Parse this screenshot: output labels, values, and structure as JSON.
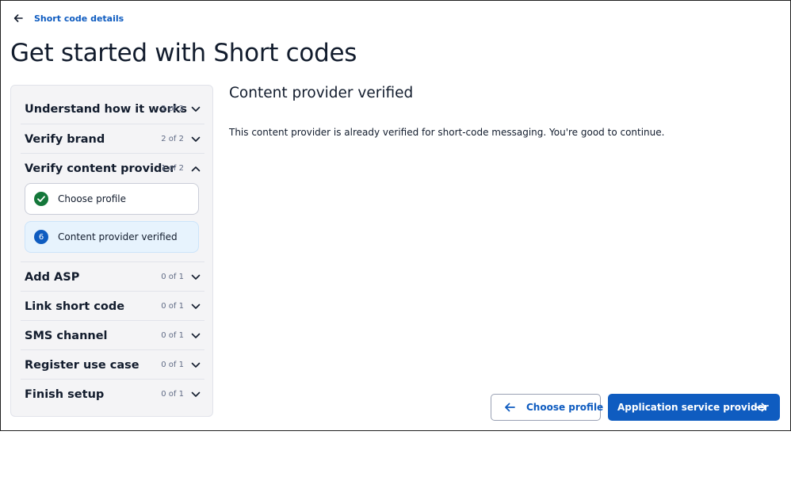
{
  "breadcrumb": {
    "label": "Short code details"
  },
  "page": {
    "title": "Get started with Short codes"
  },
  "steps": [
    {
      "title": "Understand how it works",
      "count": "2 of 2",
      "expanded": false
    },
    {
      "title": "Verify brand",
      "count": "2 of 2",
      "expanded": false
    },
    {
      "title": "Verify content provider",
      "count": "1 of 2",
      "expanded": true
    },
    {
      "title": "Add ASP",
      "count": "0 of 1",
      "expanded": false
    },
    {
      "title": "Link short code",
      "count": "0 of 1",
      "expanded": false
    },
    {
      "title": "SMS channel",
      "count": "0 of 1",
      "expanded": false
    },
    {
      "title": "Register use case",
      "count": "0 of 1",
      "expanded": false
    },
    {
      "title": "Finish setup",
      "count": "0 of 1",
      "expanded": false
    }
  ],
  "substeps": [
    {
      "label": "Choose profile",
      "status": "complete",
      "icon": "check-circle-icon"
    },
    {
      "label": "Content provider verified",
      "status": "current",
      "number": "6"
    }
  ],
  "content": {
    "title": "Content provider verified",
    "body": "This content provider is already verified for short-code messaging. You're good to continue."
  },
  "footer": {
    "back_label": "Choose profile",
    "next_label": "Application service provider"
  },
  "colors": {
    "accent": "#0f5cc0",
    "success": "#14773a",
    "current_bg": "#e7f3fd",
    "sidebar_bg": "#f4f4f6"
  }
}
